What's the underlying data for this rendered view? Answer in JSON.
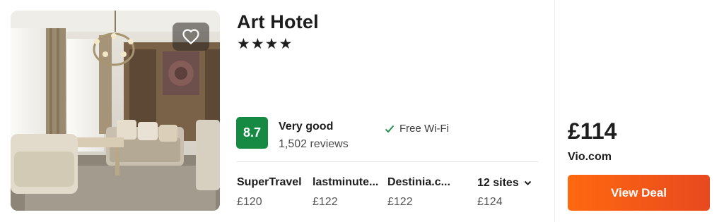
{
  "hotel": {
    "name": "Art Hotel",
    "stars_display": "★★★★",
    "star_count": 4
  },
  "rating": {
    "score": "8.7",
    "label": "Very good",
    "reviews": "1,502 reviews",
    "badge_color": "#168a43"
  },
  "amenities": [
    {
      "icon": "checkmark-icon",
      "label": "Free Wi-Fi"
    }
  ],
  "sites": [
    {
      "name": "SuperTravel",
      "price": "£120"
    },
    {
      "name": "lastminute...",
      "price": "£122"
    },
    {
      "name": "Destinia.c...",
      "price": "£122"
    }
  ],
  "more_sites": {
    "label": "12 sites",
    "price": "£124",
    "icon": "chevron-down-icon"
  },
  "deal": {
    "price": "£114",
    "provider": "Vio.com",
    "button_label": "View Deal",
    "button_color": "#ff690f"
  },
  "photo": {
    "icon": "heart-icon"
  }
}
